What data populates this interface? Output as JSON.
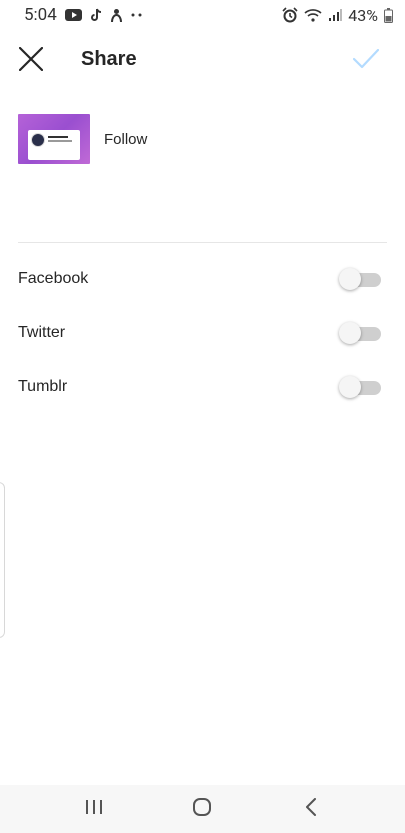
{
  "status_bar": {
    "time": "5:04",
    "battery": "43%",
    "left_icons": [
      "youtube-icon",
      "tiktok-icon",
      "person-icon",
      "more-dots-icon"
    ],
    "right_icons": [
      "alarm-icon",
      "wifi-icon",
      "signal-icon",
      "battery-icon"
    ]
  },
  "header": {
    "title": "Share",
    "close_icon": "close-icon",
    "confirm_icon": "check-icon",
    "confirm_color": "#b3dbff"
  },
  "post": {
    "caption": "Follow",
    "thumbnail_gradient": [
      "#b562d8",
      "#9a4fd0"
    ]
  },
  "share_targets": [
    {
      "label": "Facebook",
      "enabled": false
    },
    {
      "label": "Twitter",
      "enabled": false
    },
    {
      "label": "Tumblr",
      "enabled": false
    }
  ],
  "nav_bar": {
    "buttons": [
      "recent-apps-icon",
      "home-icon",
      "back-icon"
    ]
  }
}
